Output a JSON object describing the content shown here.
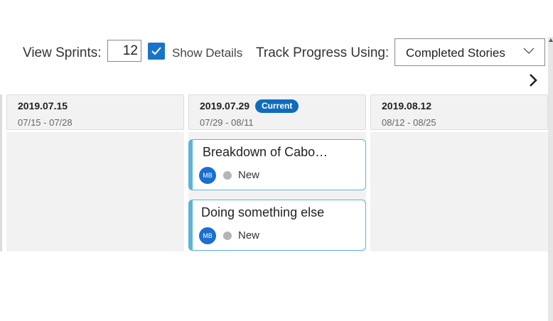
{
  "toolbar": {
    "view_sprints_label": "View Sprints:",
    "view_sprints_value": "12",
    "show_details_label": "Show Details",
    "show_details_checked": true,
    "track_progress_label": "Track Progress Using:",
    "track_progress_value": "Completed Stories"
  },
  "sprints": [
    {
      "name": "2019.07.15",
      "range": "07/15 - 07/28",
      "current": false
    },
    {
      "name": "2019.07.29",
      "range": "07/29 - 08/11",
      "current": true,
      "badge": "Current"
    },
    {
      "name": "2019.08.12",
      "range": "08/12 - 08/25",
      "current": false
    }
  ],
  "cards": [
    {
      "title": "Breakdown of Cabo…",
      "assignee_initials": "MB",
      "status": "New"
    },
    {
      "title": "Doing something else",
      "assignee_initials": "MB",
      "status": "New"
    }
  ],
  "icons": {
    "next": "chevron-right-icon",
    "dropdown": "chevron-down-icon",
    "checkbox": "checkmark-icon"
  },
  "colors": {
    "accent": "#0f6cbd",
    "card_border": "#5bb4d6",
    "status_new": "#b5b5b5"
  }
}
